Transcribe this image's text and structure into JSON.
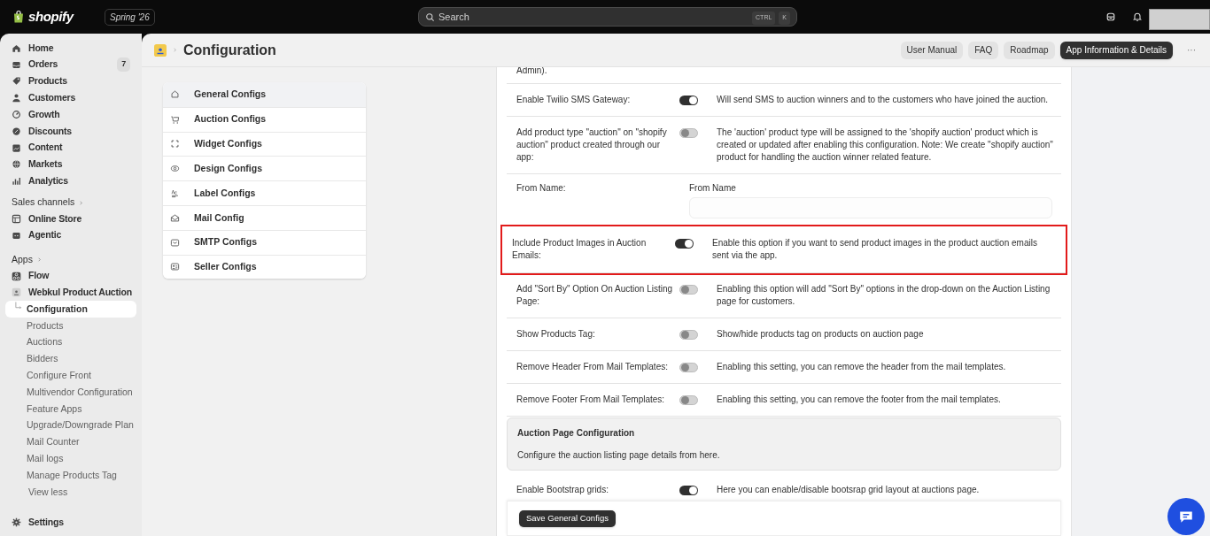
{
  "topbar": {
    "logo": "shopify",
    "edition": "Spring '26",
    "search": {
      "placeholder": "Search",
      "keys": [
        "CTRL",
        "K"
      ]
    }
  },
  "sidebar": {
    "items": [
      {
        "label": "Home"
      },
      {
        "label": "Orders",
        "badge": "7"
      },
      {
        "label": "Products"
      },
      {
        "label": "Customers"
      },
      {
        "label": "Growth"
      },
      {
        "label": "Discounts"
      },
      {
        "label": "Content"
      },
      {
        "label": "Markets"
      },
      {
        "label": "Analytics"
      }
    ],
    "sales_channels": {
      "heading": "Sales channels",
      "items": [
        {
          "label": "Online Store"
        },
        {
          "label": "Agentic"
        }
      ]
    },
    "apps": {
      "heading": "Apps",
      "items": [
        {
          "label": "Flow"
        },
        {
          "label": "Webkul Product Auction"
        }
      ],
      "sub_items": [
        {
          "label": "Configuration",
          "selected": true
        },
        {
          "label": "Products",
          "selected": false
        },
        {
          "label": "Auctions",
          "selected": false
        },
        {
          "label": "Bidders",
          "selected": false
        },
        {
          "label": "Configure Front",
          "selected": false
        },
        {
          "label": "Multivendor Configuration",
          "selected": false
        },
        {
          "label": "Feature Apps",
          "selected": false
        },
        {
          "label": "Upgrade/Downgrade Plan",
          "selected": false
        },
        {
          "label": "Mail Counter",
          "selected": false
        },
        {
          "label": "Mail logs",
          "selected": false
        },
        {
          "label": "Manage Products Tag",
          "selected": false
        }
      ],
      "view_less": "View less"
    },
    "settings": "Settings"
  },
  "page": {
    "title": "Configuration",
    "actions": [
      {
        "label": "User Manual",
        "primary": false
      },
      {
        "label": "FAQ",
        "primary": false
      },
      {
        "label": "Roadmap",
        "primary": false
      },
      {
        "label": "App Information & Details",
        "primary": true
      }
    ],
    "more": "···"
  },
  "config_nav": [
    {
      "label": "General Configs",
      "selected": true
    },
    {
      "label": "Auction Configs",
      "selected": false
    },
    {
      "label": "Widget Configs",
      "selected": false
    },
    {
      "label": "Design Configs",
      "selected": false
    },
    {
      "label": "Label Configs",
      "selected": false
    },
    {
      "label": "Mail Config",
      "selected": false
    },
    {
      "label": "SMTP Configs",
      "selected": false
    },
    {
      "label": "Seller Configs",
      "selected": false
    }
  ],
  "settings_rows": [
    {
      "kind": "text",
      "label": "Admin)."
    },
    {
      "kind": "toggle",
      "label": "Enable Twilio SMS Gateway:",
      "on": true,
      "description": "Will send SMS to auction winners and to the customers who have joined the auction.",
      "highlighted": false
    },
    {
      "kind": "toggle",
      "label": "Add product type \"auction\" on \"shopify auction\" product created through our app:",
      "on": false,
      "description": "The 'auction' product type will be assigned to the 'shopify auction' product which is created or updated after enabling this configuration. Note: We create \"shopify auction\" product for handling the auction winner related feature.",
      "highlighted": false
    },
    {
      "kind": "field",
      "label": "From Name:",
      "field_label": "From Name"
    },
    {
      "kind": "toggle",
      "label": "Include Product Images in Auction Emails:",
      "on": true,
      "description": "Enable this option if you want to send product images in the product auction emails sent via the app.",
      "highlighted": true
    },
    {
      "kind": "toggle",
      "label": "Add \"Sort By\" Option On Auction Listing Page:",
      "on": false,
      "description": "Enabling this option will add \"Sort By\" options in the drop-down on the Auction Listing page for customers.",
      "highlighted": false
    },
    {
      "kind": "toggle",
      "label": "Show Products Tag:",
      "on": false,
      "description": "Show/hide products tag on products on auction page",
      "highlighted": false
    },
    {
      "kind": "toggle",
      "label": "Remove Header From Mail Templates:",
      "on": false,
      "description": "Enabling this setting, you can remove the header from the mail templates.",
      "highlighted": false
    },
    {
      "kind": "toggle",
      "label": "Remove Footer From Mail Templates:",
      "on": false,
      "description": "Enabling this setting, you can remove the footer from the mail templates.",
      "highlighted": false
    },
    {
      "kind": "section",
      "label": "Auction Page Configuration",
      "description": "Configure the auction listing page details from here."
    },
    {
      "kind": "toggle",
      "label": "Enable Bootstrap grids:",
      "on": true,
      "description": "Here you can enable/disable bootsrap grid layout at auctions page.",
      "highlighted": false
    }
  ],
  "save_button": "Save General Configs"
}
